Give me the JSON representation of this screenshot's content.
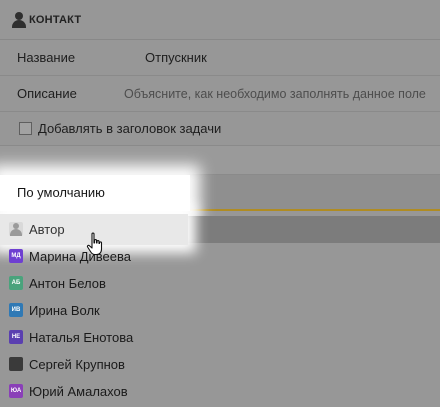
{
  "header": {
    "title": "КОНТАКТ",
    "icon": "person-icon"
  },
  "form": {
    "name_label": "Название",
    "name_value": "Отпускник",
    "description_label": "Описание",
    "description_placeholder": "Объясните, как необходимо заполнять данное поле",
    "add_to_title_label": "Добавлять в заголовок задачи"
  },
  "dropdown": {
    "selected": "По умолчанию",
    "options": [
      {
        "name": "Автор",
        "initials": "",
        "color": "#d9d9d9"
      },
      {
        "name": "Марина Дивеева",
        "initials": "МД",
        "color": "#6e3fd1"
      },
      {
        "name": "Антон Белов",
        "initials": "АБ",
        "color": "#4aa37c"
      },
      {
        "name": "Ирина Волк",
        "initials": "ИВ",
        "color": "#2f79b5"
      },
      {
        "name": "Наталья Енотова",
        "initials": "НЕ",
        "color": "#5a3fb0"
      },
      {
        "name": "Сергей Крупнов",
        "initials": "",
        "color": "#3a3a3a"
      },
      {
        "name": "Юрий Амалахов",
        "initials": "ЮА",
        "color": "#8a3fb8"
      }
    ]
  },
  "colors": {
    "accent": "#b08c22",
    "overlay": "#979797"
  }
}
